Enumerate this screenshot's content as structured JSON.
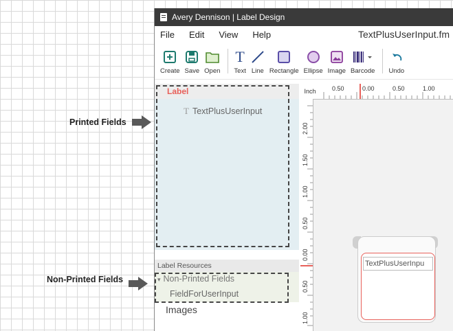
{
  "annotations": {
    "printed_label": "Printed Fields",
    "nonprinted_label": "Non-Printed Fields"
  },
  "app": {
    "title": "Avery Dennison | Label Design",
    "menu": [
      "File",
      "Edit",
      "View",
      "Help"
    ],
    "filename": "TextPlusUserInput.fm",
    "toolbar": {
      "create": "Create",
      "save": "Save",
      "open": "Open",
      "text": "Text",
      "line": "Line",
      "rectangle": "Rectangle",
      "ellipse": "Ellipse",
      "image": "Image",
      "barcode": "Barcode",
      "undo": "Undo"
    },
    "accent_color": "#e8605a"
  },
  "left_panel": {
    "label_header": "Label",
    "printed_fields": [
      "TextPlusUserInput"
    ],
    "resources_header": "Label Resources",
    "nonprinted_header": "Non-Printed Fields",
    "nonprinted_items": [
      "FieldForUserInput"
    ],
    "images": "Images"
  },
  "canvas": {
    "unit": "Inch",
    "h_ticks": [
      "0.50",
      "0.00",
      "0.50",
      "1.00"
    ],
    "v_ticks": [
      "2.00",
      "1.50",
      "1.00",
      "0.50",
      "0.00",
      "0.50",
      "1.00"
    ],
    "label_field_text": "TextPlusUserInpu"
  }
}
